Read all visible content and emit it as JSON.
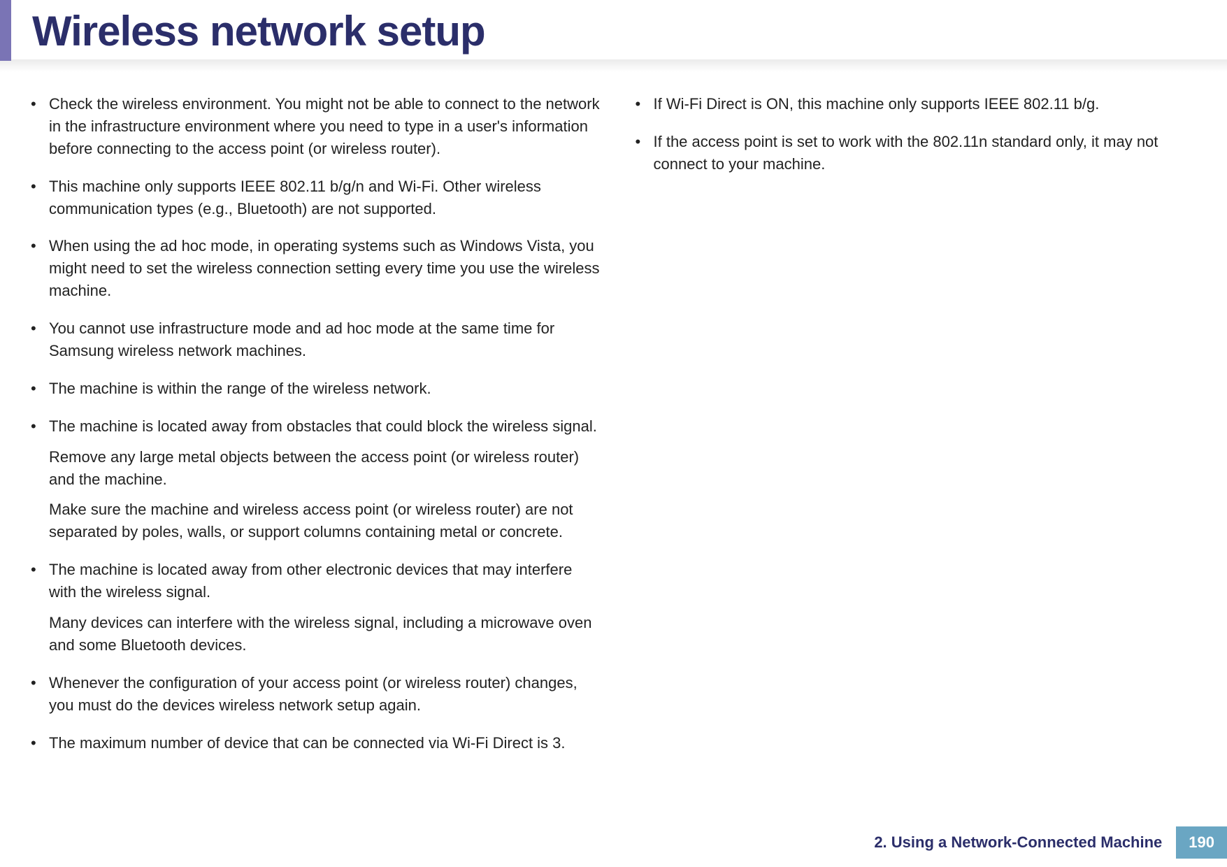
{
  "header": {
    "title": "Wireless network setup"
  },
  "left_column": {
    "items": [
      {
        "paragraphs": [
          "Check the wireless environment. You might not be able to connect to the network in the infrastructure environment where you need to type in a user's information before connecting to the access point (or wireless router)."
        ]
      },
      {
        "paragraphs": [
          "This machine only supports IEEE 802.11 b/g/n and Wi-Fi. Other wireless communication types (e.g., Bluetooth) are not supported."
        ]
      },
      {
        "paragraphs": [
          "When using the ad hoc mode, in operating systems such as Windows Vista, you might need to set the wireless connection setting every time you use the wireless machine."
        ]
      },
      {
        "paragraphs": [
          "You cannot use infrastructure mode and ad hoc mode at the same time for Samsung wireless network machines."
        ]
      },
      {
        "paragraphs": [
          "The machine is within the range of the wireless network."
        ]
      },
      {
        "paragraphs": [
          "The machine is located away from obstacles that could block the wireless signal.",
          "Remove any large metal objects between the access point (or wireless router) and the machine.",
          "Make sure the machine and wireless access point (or wireless router) are not separated by poles, walls, or support columns containing metal or concrete."
        ]
      },
      {
        "paragraphs": [
          "The machine is located away from other electronic devices that may interfere with the wireless signal.",
          "Many devices can interfere with the wireless signal, including a microwave oven and some Bluetooth devices."
        ]
      },
      {
        "paragraphs": [
          "Whenever the configuration of your access point (or wireless router) changes, you must do the devices wireless network setup again."
        ]
      },
      {
        "paragraphs": [
          "The maximum number of device that can be connected via Wi-Fi Direct is 3."
        ]
      }
    ]
  },
  "right_column": {
    "items": [
      {
        "paragraphs": [
          "If Wi-Fi Direct is ON, this machine only supports IEEE 802.11 b/g."
        ]
      },
      {
        "paragraphs": [
          "If the access point is set to work with the 802.11n standard only, it may not connect to your machine."
        ]
      }
    ]
  },
  "footer": {
    "chapter": "2.  Using a Network-Connected Machine",
    "page": "190"
  }
}
